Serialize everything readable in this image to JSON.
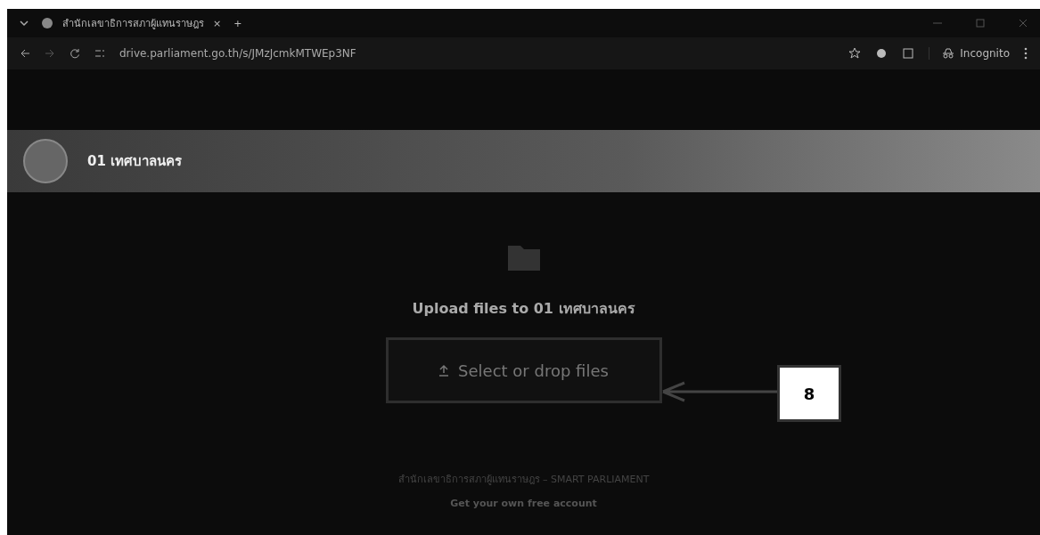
{
  "browser": {
    "tab": {
      "title": "สำนักเลขาธิการสภาผู้แทนราษฎร",
      "close": "×",
      "new_tab": "+"
    },
    "address": "drive.parliament.go.th/s/JMzJcmkMTWEp3NF",
    "incognito": "Incognito"
  },
  "header": {
    "title": "01 เทศบาลนคร"
  },
  "upload": {
    "heading": "Upload files to 01 เทศบาลนคร",
    "button": "Select or drop files"
  },
  "callout": {
    "label": "8"
  },
  "footer": {
    "org": "สำนักเลขาธิการสภาผู้แทนราษฎร – SMART PARLIAMENT",
    "link": "Get your own free account"
  }
}
